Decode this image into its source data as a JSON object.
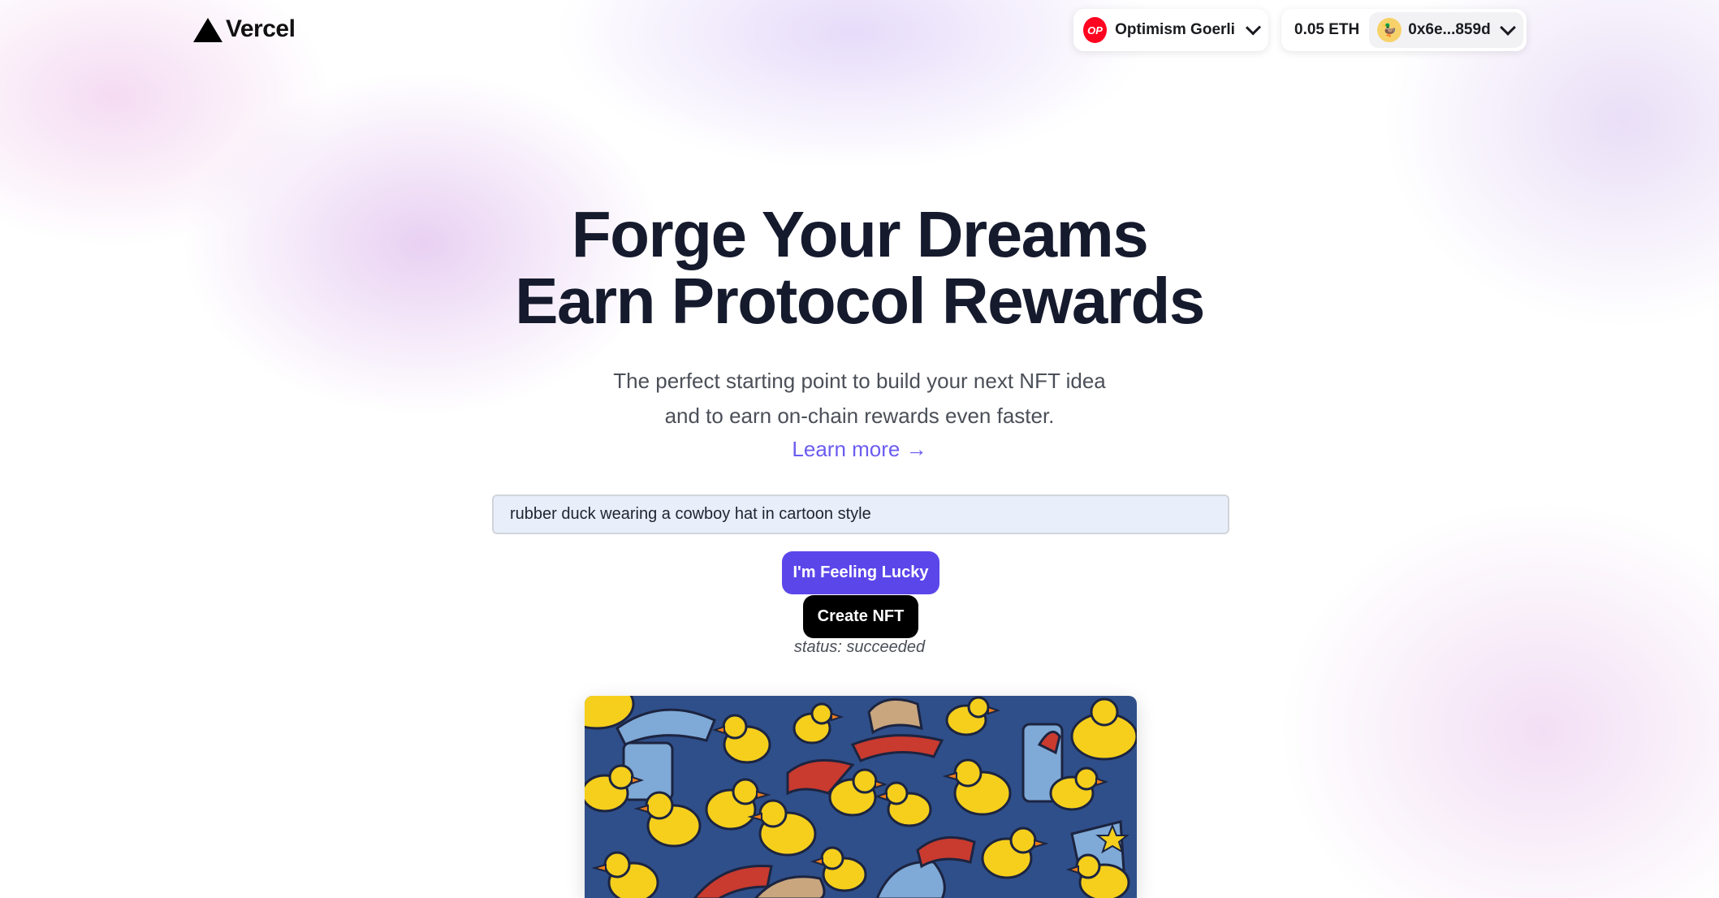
{
  "header": {
    "logo_text": "Vercel",
    "chain": {
      "icon_text": "OP",
      "name": "Optimism Goerli"
    },
    "account": {
      "balance": "0.05 ETH",
      "avatar_emoji": "🦆",
      "address": "0x6e...859d"
    }
  },
  "hero": {
    "title_line1": "Forge Your Dreams",
    "title_line2": "Earn Protocol Rewards",
    "subtitle_line1": "The perfect starting point to build your next NFT idea",
    "subtitle_line2": "and to earn on-chain rewards even faster.",
    "learn_more": "Learn more →"
  },
  "form": {
    "prompt_value": "rubber duck wearing a cowboy hat in cartoon style",
    "lucky_label": "I'm Feeling Lucky",
    "create_label": "Create NFT",
    "status_text": "status: succeeded"
  },
  "colors": {
    "primary": "#5b46ea",
    "link": "#6b5cf0",
    "chain_red": "#ff0420",
    "title": "#151a2d",
    "nft_background": "#2f4f8a",
    "duck_yellow": "#f5cf1c",
    "hat_red": "#c93a2f",
    "hat_blue": "#7fa9d6"
  }
}
